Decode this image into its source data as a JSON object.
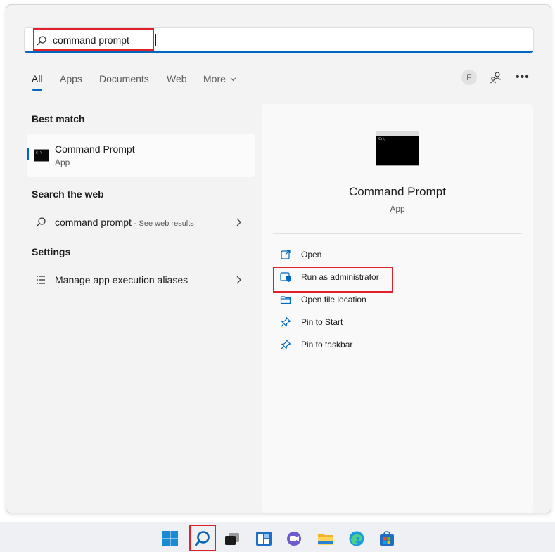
{
  "search": {
    "query": "command prompt"
  },
  "tabs": [
    {
      "label": "All"
    },
    {
      "label": "Apps"
    },
    {
      "label": "Documents"
    },
    {
      "label": "Web"
    },
    {
      "label": "More"
    }
  ],
  "header": {
    "avatar_initial": "F",
    "more_icon": "ellipsis-icon",
    "people_icon": "people-icon"
  },
  "best_match": {
    "heading": "Best match",
    "title": "Command Prompt",
    "subtitle": "App"
  },
  "search_web": {
    "heading": "Search the web",
    "query": "command prompt",
    "suffix": "- See web results"
  },
  "settings": {
    "heading": "Settings",
    "item": "Manage app execution aliases"
  },
  "preview": {
    "title": "Command Prompt",
    "subtitle": "App",
    "actions": [
      {
        "label": "Open",
        "icon": "open-icon"
      },
      {
        "label": "Run as administrator",
        "icon": "shield-icon"
      },
      {
        "label": "Open file location",
        "icon": "folder-icon"
      },
      {
        "label": "Pin to Start",
        "icon": "pin-icon"
      },
      {
        "label": "Pin to taskbar",
        "icon": "pin-icon"
      }
    ]
  },
  "taskbar": {
    "icons": [
      "windows-start-icon",
      "search-icon",
      "task-view-icon",
      "widgets-icon",
      "chat-icon",
      "file-explorer-icon",
      "edge-icon",
      "store-icon"
    ]
  },
  "colors": {
    "accent": "#0067c0",
    "highlight": "#e0202a"
  }
}
